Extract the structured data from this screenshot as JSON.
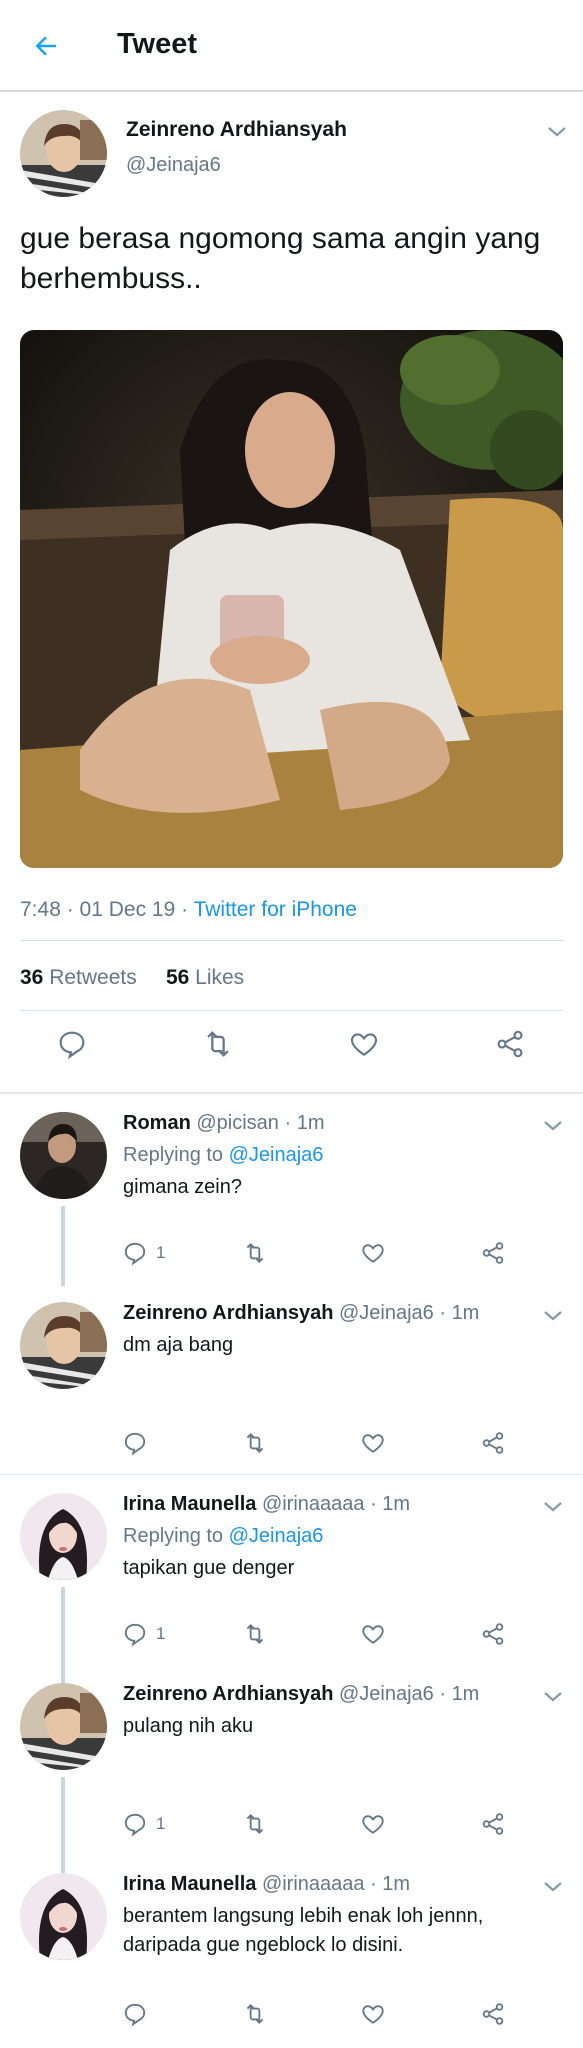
{
  "header": {
    "title": "Tweet",
    "back_icon": "arrow-left-icon",
    "accent": "#1da1f2"
  },
  "main_tweet": {
    "name": "Zeinreno Ardhiansyah",
    "handle": "@Jeinaja6",
    "text": "gue berasa ngomong sama angin yang berhembuss..",
    "time": "7:48 · 01 Dec 19 · ",
    "app": "Twitter for iPhone",
    "retweets_count": "36",
    "retweets_label": "Retweets",
    "likes_count": "56",
    "likes_label": "Likes"
  },
  "replies": [
    {
      "name": "Roman",
      "handle": "@picisan · 1m",
      "replying_prefix": "Replying to ",
      "replying_to": "@Jeinaja6",
      "text": "gimana zein?",
      "reply_count": "1"
    },
    {
      "name": "Zeinreno Ardhiansyah",
      "handle": "@Jeinaja6 · 1m",
      "text": "dm aja bang",
      "reply_count": ""
    },
    {
      "name": "Irina Maunella",
      "handle": "@irinaaaaa · 1m",
      "replying_prefix": "Replying to ",
      "replying_to": "@Jeinaja6",
      "text": "tapikan gue denger",
      "reply_count": "1"
    },
    {
      "name": "Zeinreno Ardhiansyah",
      "handle": "@Jeinaja6 · 1m",
      "text": "pulang nih aku",
      "reply_count": "1"
    },
    {
      "name": "Irina Maunella",
      "handle": "@irinaaaaa · 1m",
      "text": "berantem langsung lebih enak loh jennn, daripada gue ngeblock lo disini.",
      "reply_count": ""
    }
  ],
  "colors": {
    "link": "#1b95e0",
    "secondary": "#657786",
    "text": "#14171a"
  }
}
